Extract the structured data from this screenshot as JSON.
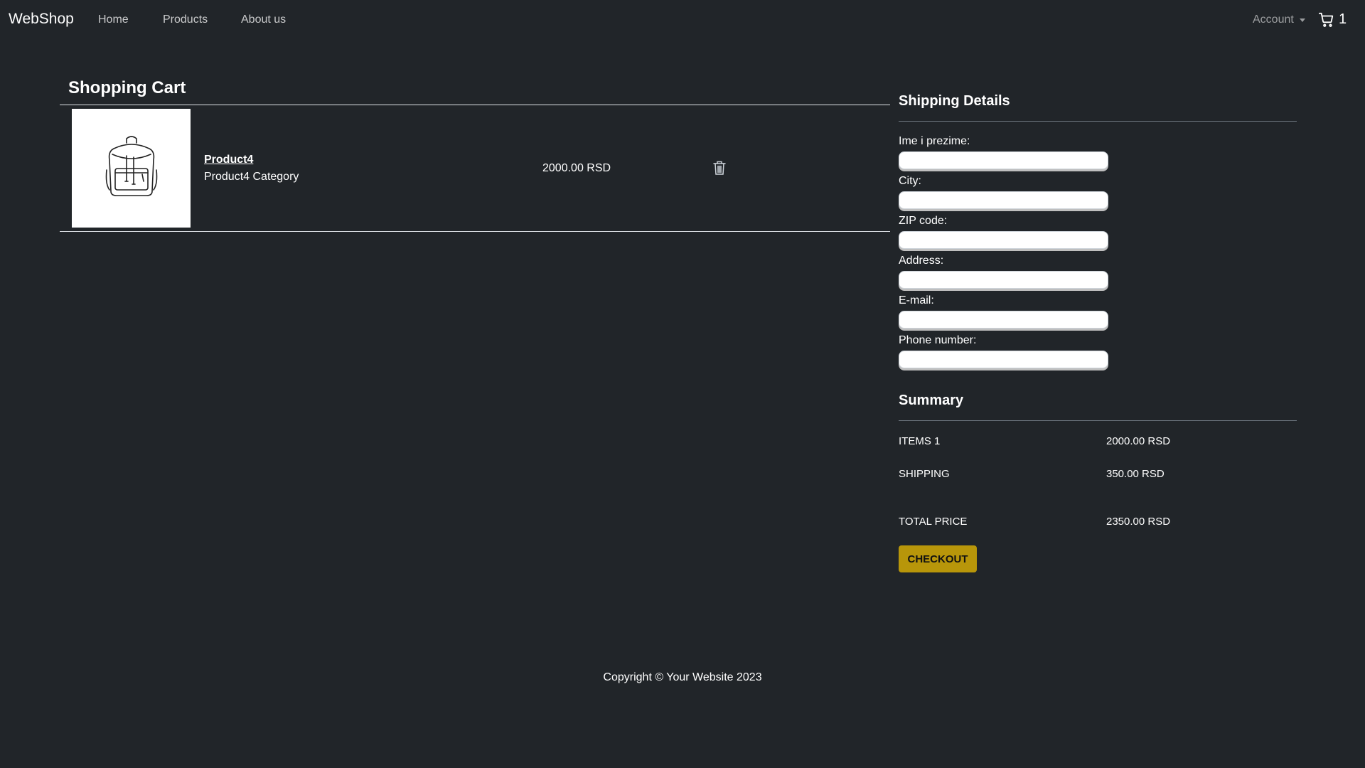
{
  "navbar": {
    "brand": "WebShop",
    "links": [
      "Home",
      "Products",
      "About us"
    ],
    "account_label": "Account",
    "cart_count": "1"
  },
  "cart": {
    "title": "Shopping Cart",
    "items": [
      {
        "name": "Product4",
        "category": "Product4 Category",
        "price": "2000.00 RSD",
        "image_icon": "backpack-icon"
      }
    ]
  },
  "shipping": {
    "title": "Shipping Details",
    "fields": [
      {
        "label": "Ime i prezime:",
        "value": ""
      },
      {
        "label": "City:",
        "value": ""
      },
      {
        "label": "ZIP code:",
        "value": ""
      },
      {
        "label": "Address:",
        "value": ""
      },
      {
        "label": "E-mail:",
        "value": ""
      },
      {
        "label": "Phone number:",
        "value": ""
      }
    ]
  },
  "summary": {
    "title": "Summary",
    "items_label": "ITEMS 1",
    "items_value": "2000.00 RSD",
    "shipping_label": "SHIPPING",
    "shipping_value": "350.00 RSD",
    "total_label": "TOTAL PRICE",
    "total_value": "2350.00 RSD",
    "checkout_label": "CHECKOUT"
  },
  "footer": {
    "text": "Copyright © Your Website 2023"
  },
  "colors": {
    "background": "#212529",
    "checkout_button": "#b8960a"
  }
}
